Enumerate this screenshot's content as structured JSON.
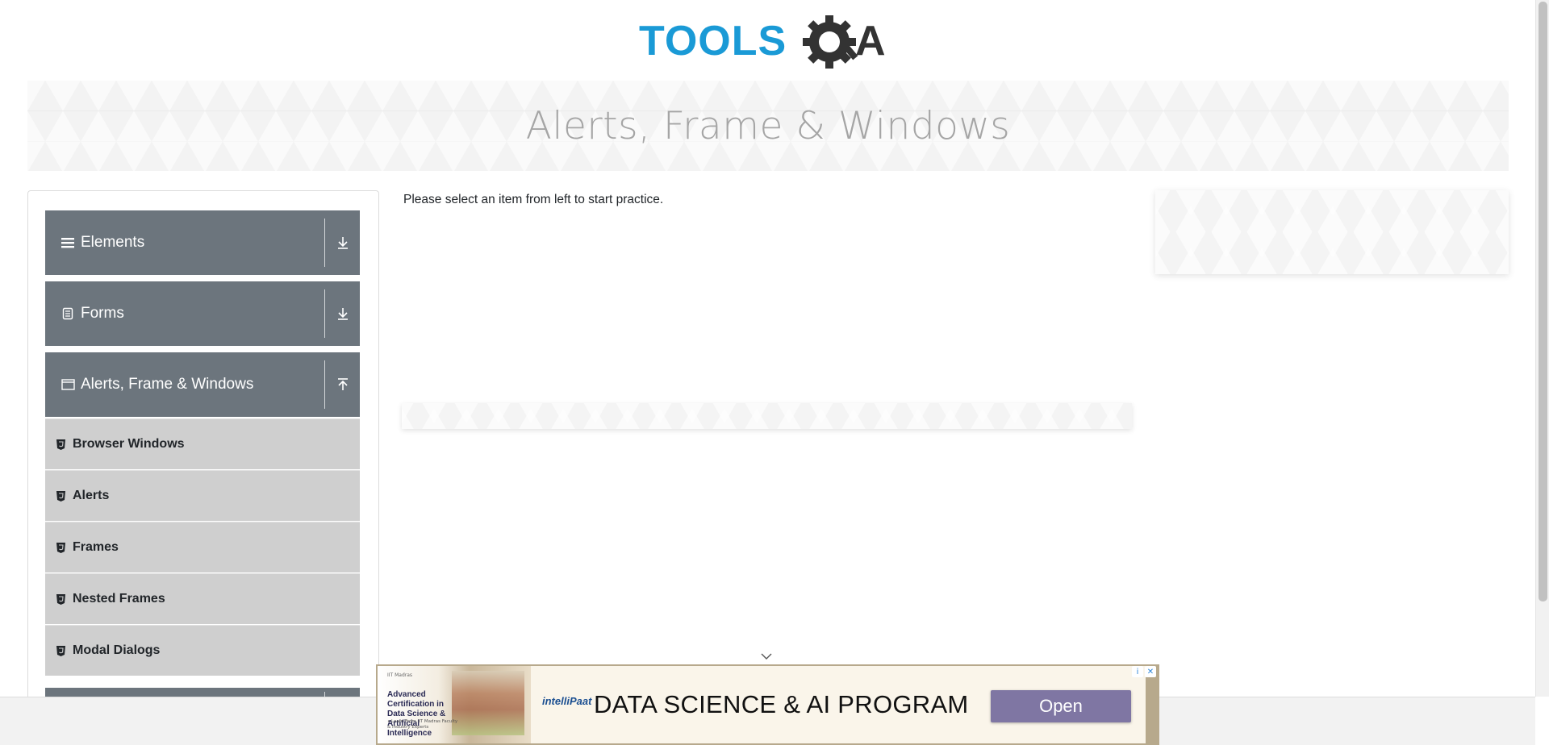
{
  "logo": {
    "text_part1": "TOOLS",
    "text_part2": "QA",
    "color_blue": "#1a9ad6",
    "color_dark": "#333333"
  },
  "banner": {
    "title": "Alerts, Frame & Windows"
  },
  "sidebar": {
    "groups": [
      {
        "label": "Elements",
        "icon": "hamburger-icon",
        "arrow": "download-icon"
      },
      {
        "label": "Forms",
        "icon": "form-icon",
        "arrow": "download-icon"
      },
      {
        "label": "Alerts, Frame & Windows",
        "icon": "window-icon",
        "arrow": "upload-icon"
      }
    ],
    "items": [
      {
        "label": "Browser Windows",
        "icon": "html5-icon"
      },
      {
        "label": "Alerts",
        "icon": "html5-icon"
      },
      {
        "label": "Frames",
        "icon": "html5-icon"
      },
      {
        "label": "Nested Frames",
        "icon": "html5-icon"
      },
      {
        "label": "Modal Dialogs",
        "icon": "html5-icon"
      }
    ]
  },
  "main": {
    "instruction": "Please select an item from left to start practice."
  },
  "ad": {
    "thumb_source": "IIT Madras",
    "thumb_title": "Advanced Certification in Data Science & Artificial Intelligence",
    "thumb_bullets": "• Learn From IIT Madras Faculty & Industry Experts",
    "brand": "intelliPaat",
    "headline": "DATA SCIENCE & AI PROGRAM",
    "cta": "Open",
    "adchoice_info": "i",
    "adchoice_close": "✕"
  },
  "colors": {
    "menu_header": "#6c757d",
    "menu_item": "#cfcfcf",
    "ad_button": "#7f76a3"
  }
}
